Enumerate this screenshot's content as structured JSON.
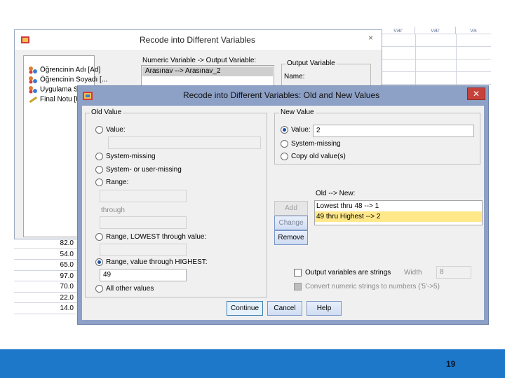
{
  "spreadsheet": {
    "col_headers": [
      "var",
      "var",
      "va"
    ],
    "left_values": [
      "82.0",
      "54.0",
      "65.0",
      "97.0",
      "70.0",
      "22.0",
      "14.0"
    ]
  },
  "back_dialog": {
    "title": "Recode into Different Variables",
    "close_glyph": "×",
    "variables": [
      "Öğrencinin Adı [Ad]",
      "Öğrencinin Soyadı [...",
      "Uygulama S",
      "Final Notu [F"
    ],
    "numeric_label": "Numeric Variable -> Output Variable:",
    "numeric_selected": "Arasınav --> Arasınav_2",
    "output_group": "Output Variable",
    "name_label": "Name:"
  },
  "dialog": {
    "title": "Recode into Different Variables: Old and New Values",
    "close_glyph": "✕",
    "old_value": {
      "legend": "Old Value",
      "value_label": "Value:",
      "value": "",
      "system_missing": "System-missing",
      "sys_user_missing": "System- or user-missing",
      "range_label": "Range:",
      "through_label": "through",
      "range_lowest": "Range, LOWEST through value:",
      "range_highest": "Range, value through HIGHEST:",
      "highest_value": "49",
      "all_other": "All other values"
    },
    "new_value": {
      "legend": "New Value",
      "value_label": "Value:",
      "value": "2",
      "system_missing": "System-missing",
      "copy_old": "Copy old value(s)"
    },
    "old_new": {
      "label": "Old --> New:",
      "rows": [
        "Lowest thru 48 --> 1",
        "49 thru Highest --> 2"
      ],
      "selected_index": 1
    },
    "buttons": {
      "add": "Add",
      "change": "Change",
      "remove": "Remove"
    },
    "options": {
      "strings_label": "Output variables are strings",
      "width_label": "Width",
      "width_value": "8",
      "convert_label": "Convert numeric strings to numbers ('5'->5)"
    },
    "footer_buttons": {
      "continue": "Continue",
      "cancel": "Cancel",
      "help": "Help"
    }
  },
  "slide": {
    "page_number": "19"
  }
}
